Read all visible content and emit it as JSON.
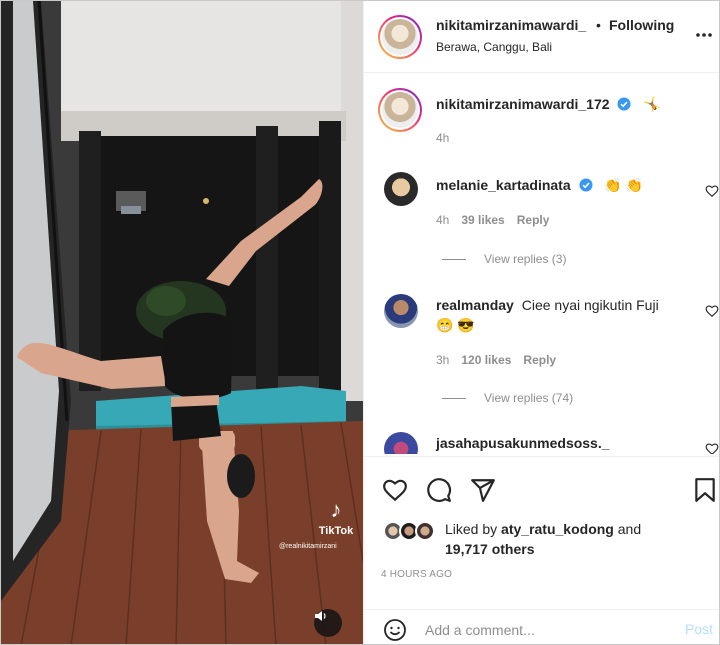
{
  "media": {
    "tiktok_label": "TikTok",
    "tiktok_user": "@realnikitamirzani",
    "sound_icon": "speaker-icon"
  },
  "header": {
    "username": "nikitamirzanimawardi_",
    "separator": "•",
    "follow_label": "Following",
    "location": "Berawa, Canggu, Bali"
  },
  "caption": {
    "username": "nikitamirzanimawardi_172",
    "text": "🤸",
    "time": "4h"
  },
  "comments": [
    {
      "username": "melanie_kartadinata",
      "verified": true,
      "text": "👏 👏",
      "time": "4h",
      "likes": "39 likes",
      "reply_label": "Reply",
      "view_replies": "View replies (3)"
    },
    {
      "username": "realmanday",
      "verified": false,
      "text": "Ciee nyai ngikutin Fuji",
      "text2": "😁 😎",
      "time": "3h",
      "likes": "120 likes",
      "reply_label": "Reply",
      "view_replies": "View replies (74)"
    },
    {
      "username": "jasahapusakunmedsoss._",
      "verified": false,
      "text": ""
    }
  ],
  "likes": {
    "prefix": "Liked by",
    "user": "aty_ratu_kodong",
    "and": "and",
    "count": "19,717",
    "others": "others"
  },
  "timestamp": "4 HOURS AGO",
  "comment_box": {
    "placeholder": "Add a comment...",
    "post_label": "Post"
  },
  "colors": {
    "verified": "#3897f0",
    "link_disabled": "#b2dffc",
    "muted": "#8e8e8e"
  }
}
